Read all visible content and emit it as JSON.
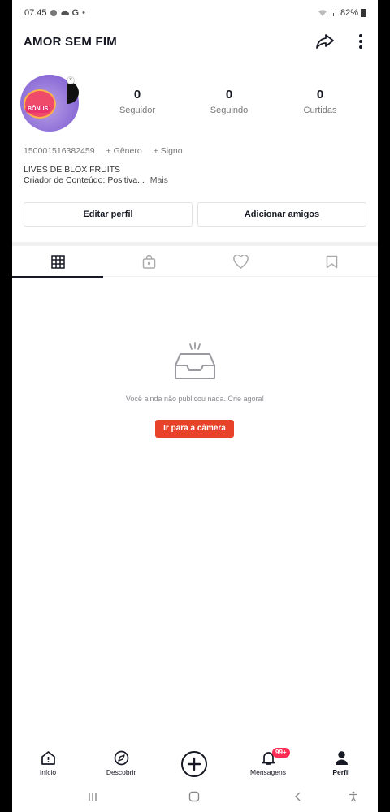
{
  "status_bar": {
    "time": "07:45",
    "icons_left": [
      "notification-dot-icon",
      "cloud-icon",
      "google-icon",
      "dot-icon"
    ],
    "battery": "82%"
  },
  "header": {
    "title": "AMOR SEM FIM",
    "share_icon": "share-arrow-icon",
    "more_icon": "more-vertical-icon"
  },
  "profile": {
    "avatar_badge": "BÔNUS",
    "stats": [
      {
        "value": "0",
        "label": "Seguidor"
      },
      {
        "value": "0",
        "label": "Seguindo"
      },
      {
        "value": "0",
        "label": "Curtidas"
      }
    ],
    "user_id": "150001516382459",
    "gender_label": "+ Gênero",
    "sign_label": "+ Signo",
    "bio_line1": "LIVES DE BLOX FRUITS",
    "bio_line2": "Criador de Conteúdo: Positiva...",
    "bio_more": "Mais"
  },
  "actions": {
    "edit": "Editar perfil",
    "add_friends": "Adicionar amigos"
  },
  "tabs": [
    {
      "icon": "grid-icon",
      "active": true
    },
    {
      "icon": "lock-bag-icon",
      "active": false
    },
    {
      "icon": "heart-icon",
      "active": false
    },
    {
      "icon": "bookmark-icon",
      "active": false
    }
  ],
  "empty_state": {
    "icon": "inbox-tray-icon",
    "message": "Você ainda não publicou nada. Crie agora!",
    "cta": "Ir para a câmera"
  },
  "bottom_nav": {
    "items": [
      {
        "label": "Início",
        "icon": "home-icon",
        "active": false
      },
      {
        "label": "Descobrir",
        "icon": "compass-icon",
        "active": false
      },
      {
        "label": "",
        "icon": "plus-icon",
        "active": false
      },
      {
        "label": "Mensagens",
        "icon": "bell-icon",
        "active": false
      },
      {
        "label": "Perfil",
        "icon": "profile-icon",
        "active": true
      }
    ],
    "messages_badge": "99+"
  },
  "colors": {
    "accent": "#e8422b",
    "badge": "#fe2c55",
    "text": "#161823",
    "muted": "#777777"
  }
}
